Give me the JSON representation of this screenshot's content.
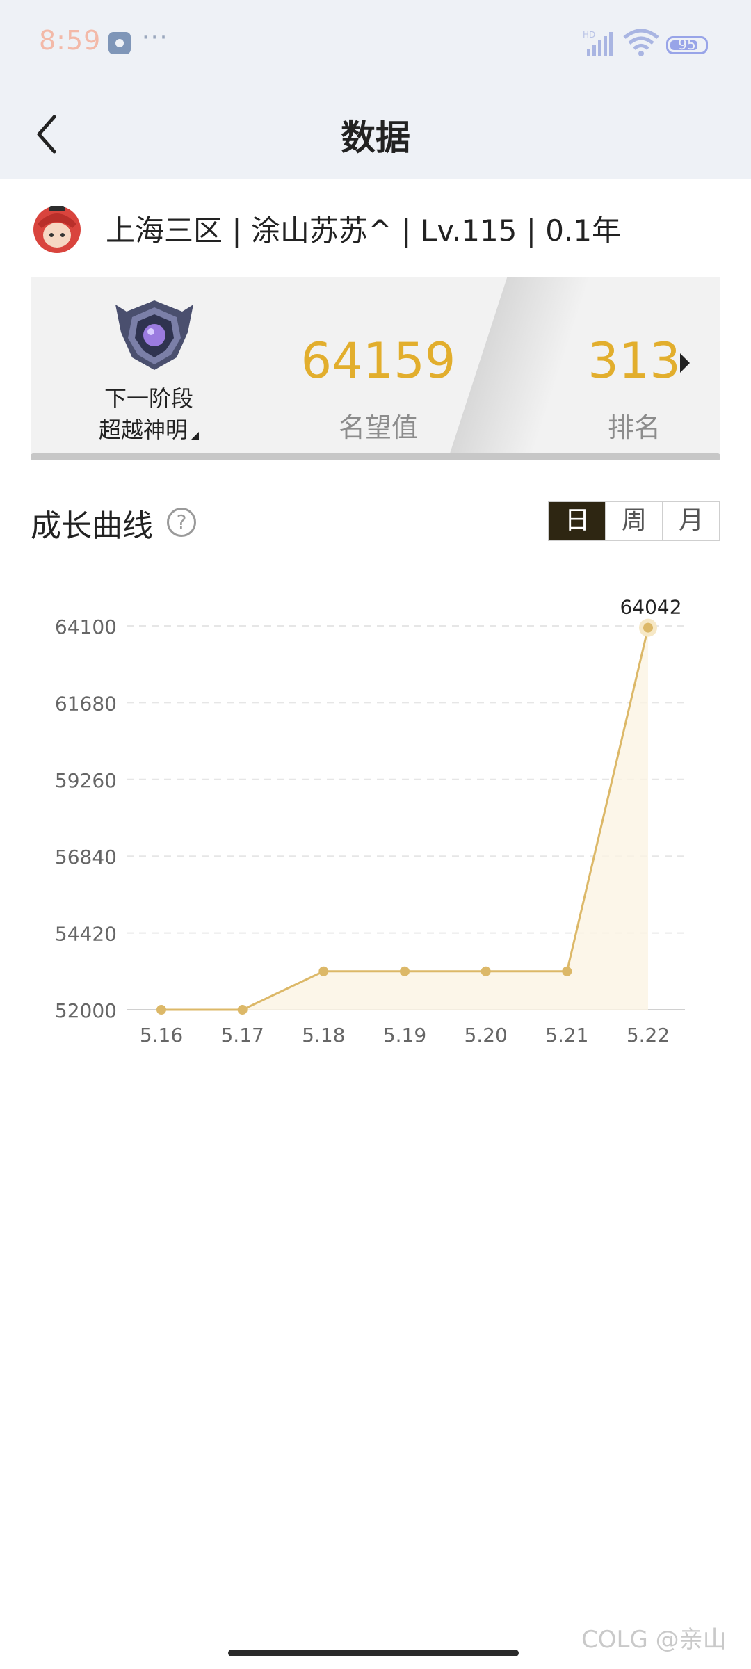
{
  "status_bar": {
    "time": "8:59",
    "dots": "···",
    "network_label": "HD",
    "battery_level": "95"
  },
  "nav": {
    "title": "数据",
    "back_icon": "chevron-left-icon"
  },
  "profile": {
    "summary": "上海三区 | 涂山苏苏^ | Lv.115 | 0.1年",
    "avatar_icon": "avatar-icon"
  },
  "stats": {
    "next_stage_label": "下一阶段",
    "next_tier": "超越神明",
    "fame_value": "64159",
    "fame_label": "名望值",
    "rank_value": "313",
    "rank_label": "排名",
    "accent_color": "#e2ae2d"
  },
  "growth": {
    "title": "成长曲线",
    "help_icon": "question-icon",
    "help_glyph": "?",
    "tabs": [
      "日",
      "周",
      "月"
    ],
    "active_tab": 0
  },
  "chart_data": {
    "type": "line",
    "categories": [
      "5.16",
      "5.17",
      "5.18",
      "5.19",
      "5.20",
      "5.21",
      "5.22"
    ],
    "values": [
      52000,
      52000,
      53210,
      53210,
      53210,
      53210,
      64042
    ],
    "y_ticks": [
      "52000",
      "54420",
      "56840",
      "59260",
      "61680",
      "64100"
    ],
    "ylim": [
      52000,
      64100
    ],
    "last_point_label": "64042",
    "grid": true,
    "line_color": "#dcb868"
  },
  "watermark": "COLG @亲山"
}
